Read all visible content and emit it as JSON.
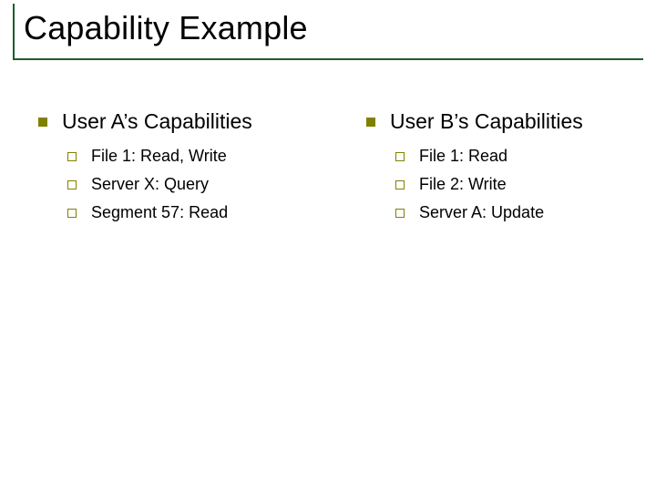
{
  "title": "Capability Example",
  "left": {
    "heading": "User A’s Capabilities",
    "items": [
      "File 1:  Read, Write",
      "Server X:  Query",
      "Segment 57:  Read"
    ]
  },
  "right": {
    "heading": "User B’s Capabilities",
    "items": [
      "File 1:  Read",
      "File 2:  Write",
      "Server A:  Update"
    ]
  }
}
